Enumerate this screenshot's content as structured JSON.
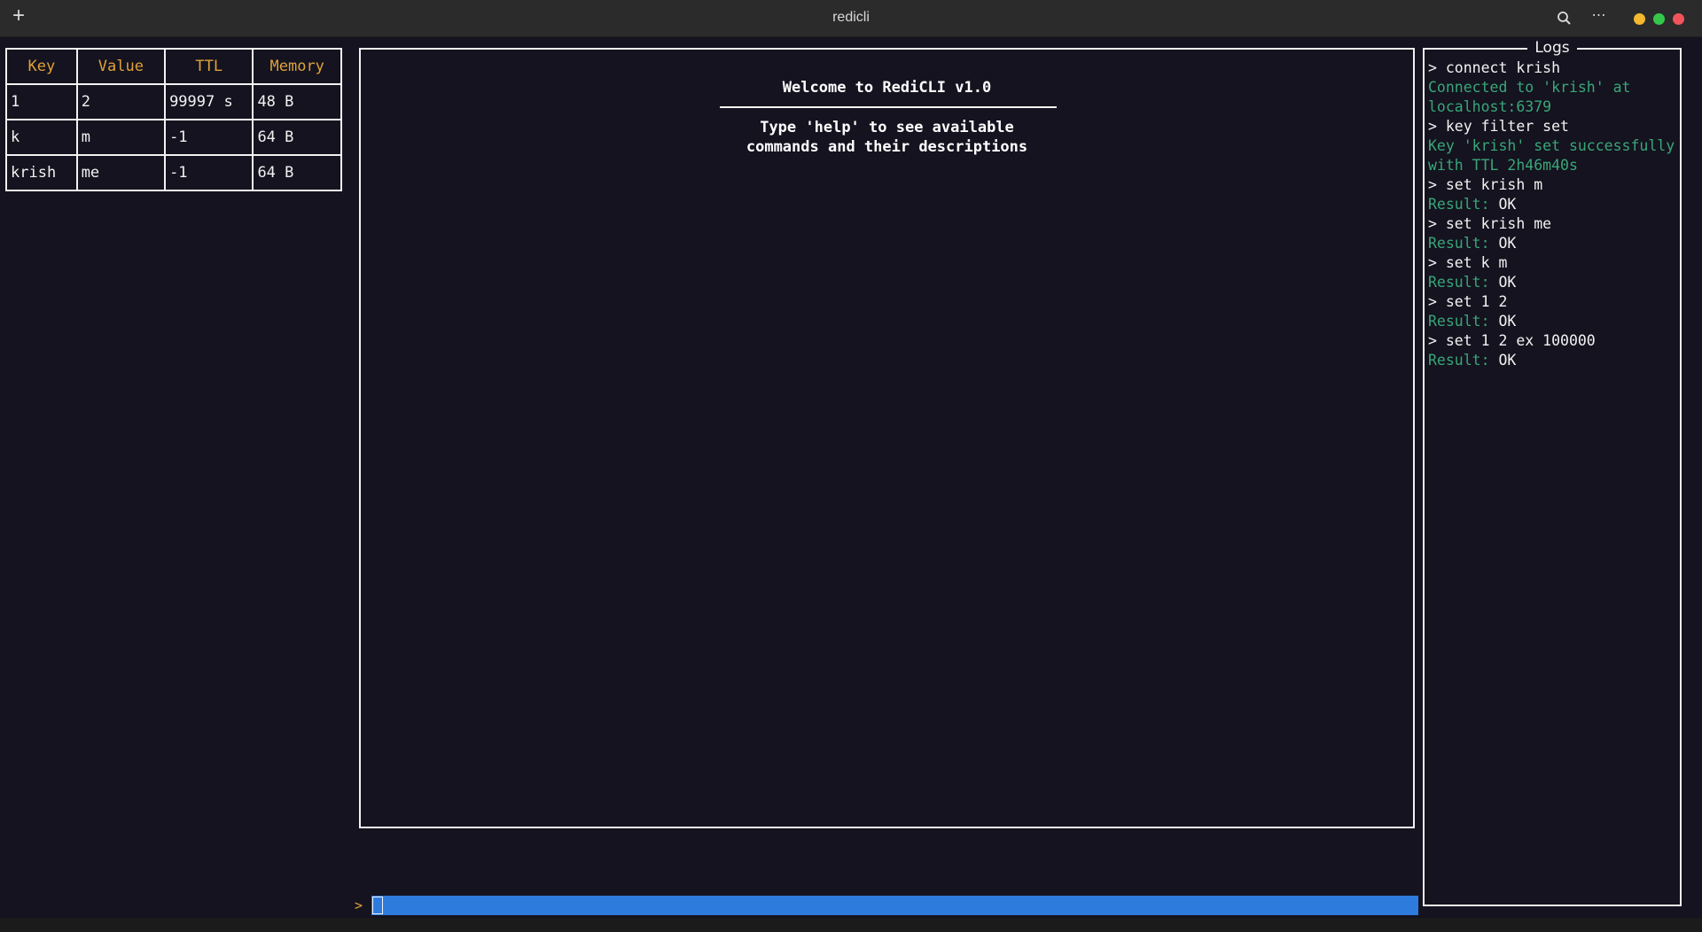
{
  "window": {
    "title": "redicli",
    "new_tab_symbol": "+",
    "more_symbol": "⋯"
  },
  "keys_table": {
    "headers": [
      "Key",
      "Value",
      "TTL",
      "Memory"
    ],
    "rows": [
      [
        "1",
        "2",
        "99997 s",
        "48 B"
      ],
      [
        "k",
        "m",
        "-1",
        "64 B"
      ],
      [
        "krish",
        "me",
        "-1",
        "64 B"
      ]
    ]
  },
  "main": {
    "welcome_title": "Welcome to RediCLI v1.0",
    "hint_line1": "Type 'help' to see available",
    "hint_line2": "commands and their descriptions"
  },
  "logs": {
    "title": "Logs",
    "lines": [
      {
        "kind": "cmd",
        "text": "> connect krish"
      },
      {
        "kind": "ok",
        "text": "Connected to 'krish' at localhost:6379"
      },
      {
        "kind": "cmd",
        "text": "> key filter set"
      },
      {
        "kind": "ok",
        "text": "Key 'krish' set successfully with TTL 2h46m40s"
      },
      {
        "kind": "cmd",
        "text": "> set krish m"
      },
      {
        "kind": "result",
        "label": "Result: ",
        "value": "OK"
      },
      {
        "kind": "cmd",
        "text": "> set krish me"
      },
      {
        "kind": "result",
        "label": "Result: ",
        "value": "OK"
      },
      {
        "kind": "cmd",
        "text": "> set k m"
      },
      {
        "kind": "result",
        "label": "Result: ",
        "value": "OK"
      },
      {
        "kind": "cmd",
        "text": "> set 1 2"
      },
      {
        "kind": "result",
        "label": "Result: ",
        "value": "OK"
      },
      {
        "kind": "cmd",
        "text": "> set 1 2 ex 100000"
      },
      {
        "kind": "result",
        "label": "Result: ",
        "value": "OK"
      }
    ]
  },
  "prompt": {
    "symbol": ">",
    "value": ""
  },
  "colors": {
    "background": "#14131f",
    "header_text": "#e0a23a",
    "success_text": "#3aa678",
    "input_bar": "#2e7bde"
  }
}
